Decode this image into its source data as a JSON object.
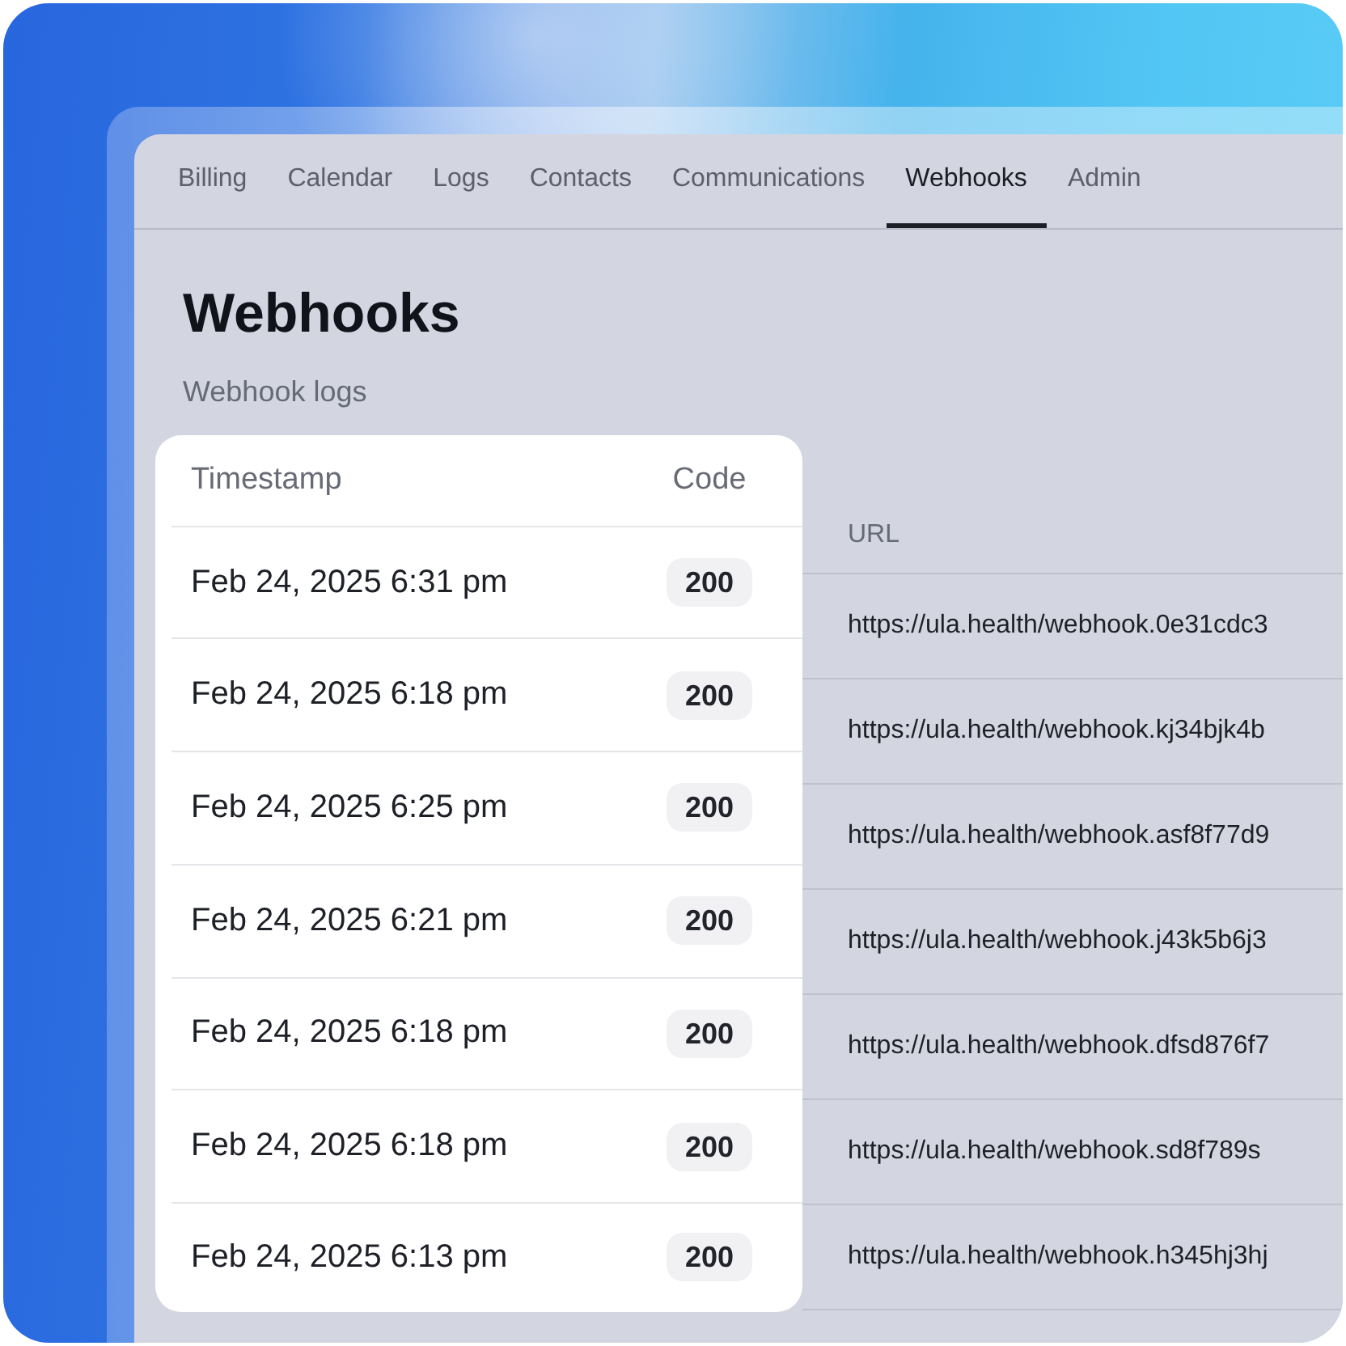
{
  "tabs": [
    {
      "label": "Billing",
      "selected": false
    },
    {
      "label": "Calendar",
      "selected": false
    },
    {
      "label": "Logs",
      "selected": false
    },
    {
      "label": "Contacts",
      "selected": false
    },
    {
      "label": "Communications",
      "selected": false
    },
    {
      "label": "Webhooks",
      "selected": true
    },
    {
      "label": "Admin",
      "selected": false
    }
  ],
  "page": {
    "title": "Webhooks",
    "subtitle": "Webhook logs"
  },
  "table": {
    "columns": [
      "Timestamp",
      "Code",
      "URL"
    ],
    "rows": [
      {
        "timestamp": "Feb 24, 2025 6:31 pm",
        "code": "200",
        "url": "https://ula.health/webhook.0e31cdc3"
      },
      {
        "timestamp": "Feb 24, 2025 6:18 pm",
        "code": "200",
        "url": "https://ula.health/webhook.kj34bjk4b"
      },
      {
        "timestamp": "Feb 24, 2025 6:25 pm",
        "code": "200",
        "url": "https://ula.health/webhook.asf8f77d9"
      },
      {
        "timestamp": "Feb 24, 2025 6:21 pm",
        "code": "200",
        "url": "https://ula.health/webhook.j43k5b6j3"
      },
      {
        "timestamp": "Feb 24, 2025 6:18 pm",
        "code": "200",
        "url": "https://ula.health/webhook.dfsd876f7"
      },
      {
        "timestamp": "Feb 24, 2025 6:18 pm",
        "code": "200",
        "url": "https://ula.health/webhook.sd8f789s"
      },
      {
        "timestamp": "Feb 24, 2025 6:13 pm",
        "code": "200",
        "url": "https://ula.health/webhook.h345hj3hj"
      }
    ]
  }
}
